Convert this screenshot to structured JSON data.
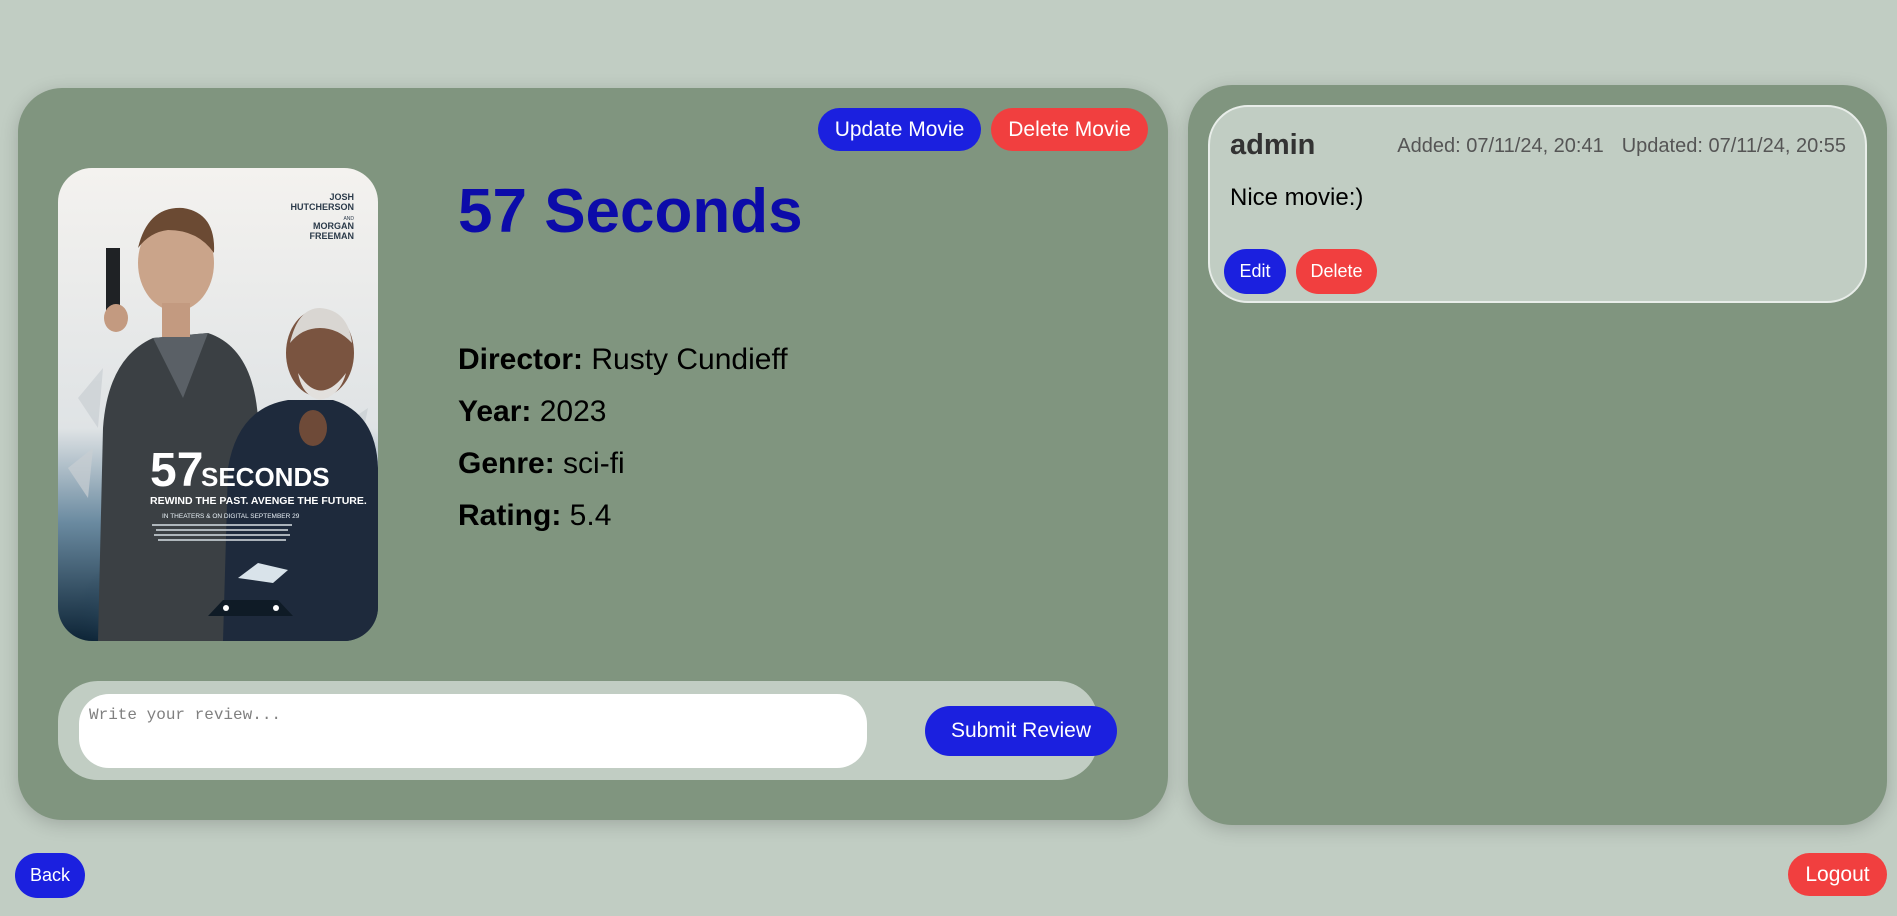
{
  "movie": {
    "title": "57 Seconds",
    "update_label": "Update Movie",
    "delete_label": "Delete Movie",
    "details": [
      {
        "label": "Director:",
        "value": "Rusty Cundieff"
      },
      {
        "label": "Year:",
        "value": "2023"
      },
      {
        "label": "Genre:",
        "value": "sci-fi"
      },
      {
        "label": "Rating:",
        "value": "5.4"
      }
    ],
    "poster": {
      "title_big": "57",
      "title_small": "SECONDS",
      "tagline": "REWIND THE PAST. AVENGE THE FUTURE.",
      "release": "IN THEATERS & ON DIGITAL SEPTEMBER 29",
      "actor1_first": "JOSH",
      "actor1_last": "HUTCHERSON",
      "and": "AND",
      "actor2_first": "MORGAN",
      "actor2_last": "FREEMAN"
    }
  },
  "review_form": {
    "placeholder": "Write your review...",
    "submit_label": "Submit Review"
  },
  "reviews": [
    {
      "author": "admin",
      "added": "Added: 07/11/24, 20:41",
      "updated": "Updated: 07/11/24, 20:55",
      "text": "Nice movie:)",
      "edit_label": "Edit",
      "delete_label": "Delete"
    }
  ],
  "nav": {
    "back_label": "Back",
    "logout_label": "Logout"
  },
  "colors": {
    "page_bg": "#c1cdc3",
    "panel_bg": "#80957f",
    "primary": "#1b20df",
    "danger": "#f13f3f",
    "title": "#0c0ba9"
  }
}
